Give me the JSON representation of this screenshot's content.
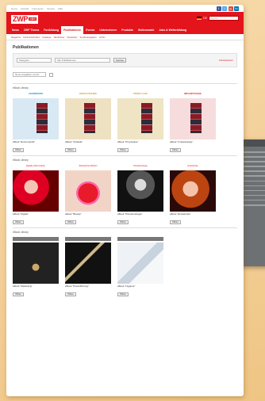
{
  "top_links": [
    "Home",
    "Kontakt",
    "Impressum",
    "Service",
    "Hilfe"
  ],
  "brand": {
    "logo": "ZWP",
    "sub": "online"
  },
  "header": {
    "lang": "DE",
    "search_placeholder": "Suche"
  },
  "nav": [
    "News",
    "ZWP Thema",
    "Fortbildung",
    "Publikationen",
    "Events",
    "Unternehmen",
    "Produkte",
    "Stellenmarkt",
    "Jobs & Weiterbildung"
  ],
  "subnav": [
    "Magazine",
    "Fachzeitschriften",
    "Kataloge",
    "Jahrbücher",
    "Newsletter",
    "Sonderausgaben",
    "Archiv"
  ],
  "page_title": "Publikationen",
  "filters": {
    "select1": "Kategorie",
    "select2": "Alle Publikationen",
    "button": "Suchen",
    "reset": "Zurücksetzen"
  },
  "fresh_label": "Neue Ausgaben zuerst",
  "sections": [
    {
      "title": "eBook Library",
      "cards": [
        {
          "label": "ZAHNMEDIZIN",
          "title": "eBook \"Endo-Hybrid\"",
          "button": "Öffnen"
        },
        {
          "label": "DENTALTECHNIK",
          "title": "eBook \"Ästhetik\"",
          "button": "Öffnen"
        },
        {
          "label": "PROPHYLAXE",
          "title": "eBook \"Prophylaxe\"",
          "button": "Öffnen"
        },
        {
          "label": "IMPLANTOLOGIE",
          "title": "eBook \"Implantologie\"",
          "button": "Öffnen"
        }
      ]
    },
    {
      "title": "eBook Library",
      "cards": [
        {
          "label": "Digitale Zahnmedizin",
          "title": "eBook \"Digital\"",
          "button": "Öffnen"
        },
        {
          "label": "Ästhetische Medizin",
          "title": "eBook \"Beauty\"",
          "button": "Öffnen"
        },
        {
          "label": "Parodontologie",
          "title": "eBook \"Parodontologie\"",
          "button": "Öffnen"
        },
        {
          "label": "Endodontie",
          "title": "eBook \"Endodontie\"",
          "button": "Öffnen"
        }
      ]
    },
    {
      "title": "eBook Library",
      "cards": [
        {
          "label": "",
          "title": "eBook \"Marketing\"",
          "button": "Öffnen"
        },
        {
          "label": "",
          "title": "eBook \"Praxisführung\"",
          "button": "Öffnen"
        },
        {
          "label": "",
          "title": "eBook \"Hygiene\"",
          "button": "Öffnen"
        }
      ]
    }
  ]
}
